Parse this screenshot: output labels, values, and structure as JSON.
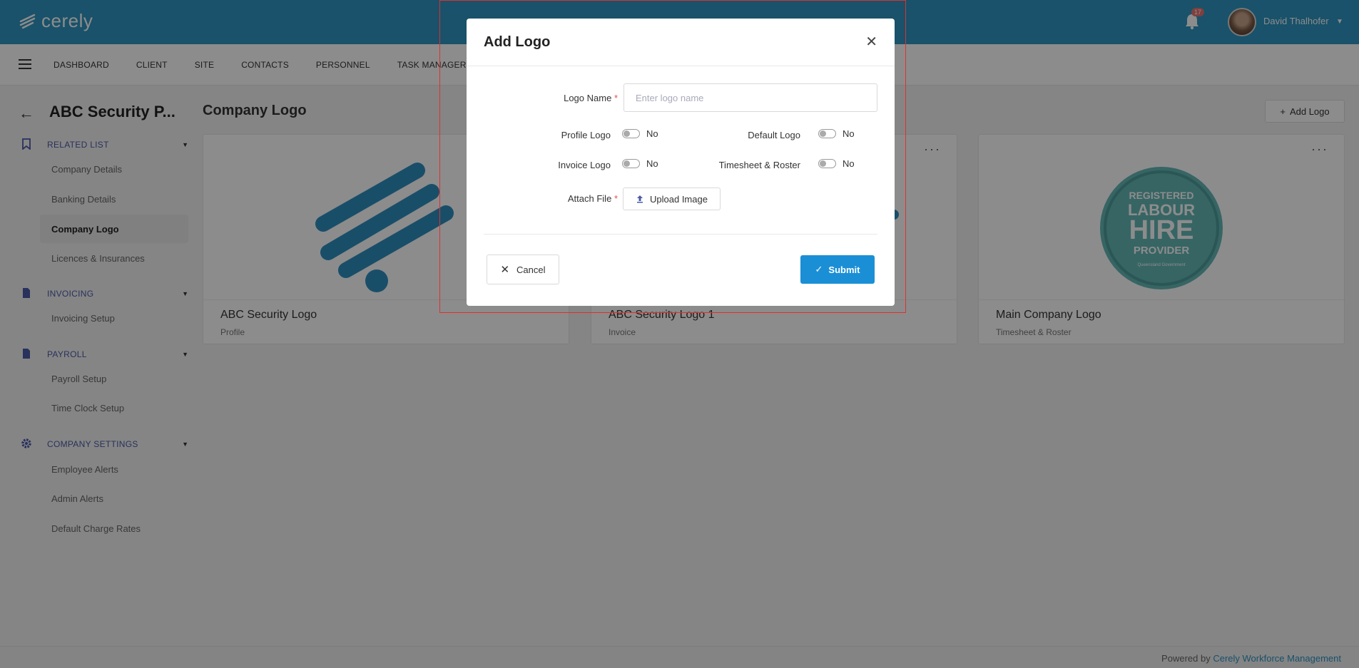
{
  "app": {
    "brand": "cerely"
  },
  "header": {
    "notification_count": "17",
    "user_name": "David Thalhofer"
  },
  "nav": {
    "items": [
      "DASHBOARD",
      "CLIENT",
      "SITE",
      "CONTACTS",
      "PERSONNEL",
      "TASK MANAGER"
    ]
  },
  "sidebar": {
    "org_title": "ABC Security P...",
    "related_list": {
      "label": "RELATED LIST",
      "items": [
        "Company Details",
        "Banking Details",
        "Company Logo",
        "Licences & Insurances"
      ]
    },
    "invoicing": {
      "label": "INVOICING",
      "items": [
        "Invoicing Setup"
      ]
    },
    "payroll": {
      "label": "PAYROLL",
      "items": [
        "Payroll Setup",
        "Time Clock Setup"
      ]
    },
    "company_settings": {
      "label": "COMPANY SETTINGS",
      "items": [
        "Employee Alerts",
        "Admin Alerts",
        "Default Charge Rates"
      ]
    }
  },
  "main": {
    "title": "Company Logo",
    "add_logo_label": "Add Logo",
    "cards": [
      {
        "title": "ABC Security Logo",
        "subtitle": "Profile"
      },
      {
        "title": "ABC Security Logo 1",
        "subtitle": "Invoice"
      },
      {
        "title": "Main Company Logo",
        "subtitle": "Timesheet & Roster"
      }
    ],
    "badge_text": {
      "line1": "REGISTERED",
      "line2": "LABOUR",
      "line3": "HIRE",
      "line4": "PROVIDER",
      "line5": "Queensland Government"
    }
  },
  "modal": {
    "title": "Add Logo",
    "logo_name_label": "Logo Name",
    "logo_name_placeholder": "Enter logo name",
    "profile_logo_label": "Profile Logo",
    "profile_logo_value": "No",
    "default_logo_label": "Default Logo",
    "default_logo_value": "No",
    "invoice_logo_label": "Invoice Logo",
    "invoice_logo_value": "No",
    "timesheet_label": "Timesheet & Roster",
    "timesheet_value": "No",
    "attach_file_label": "Attach File",
    "upload_label": "Upload Image",
    "cancel_label": "Cancel",
    "submit_label": "Submit",
    "required_mark": "*"
  },
  "footer": {
    "prefix": "Powered by",
    "link": "Cerely Workforce Management"
  },
  "colors": {
    "brand": "#2f95c2",
    "accent": "#1a8fd6",
    "section": "#4b5aa8",
    "highlight": "#e03030"
  }
}
